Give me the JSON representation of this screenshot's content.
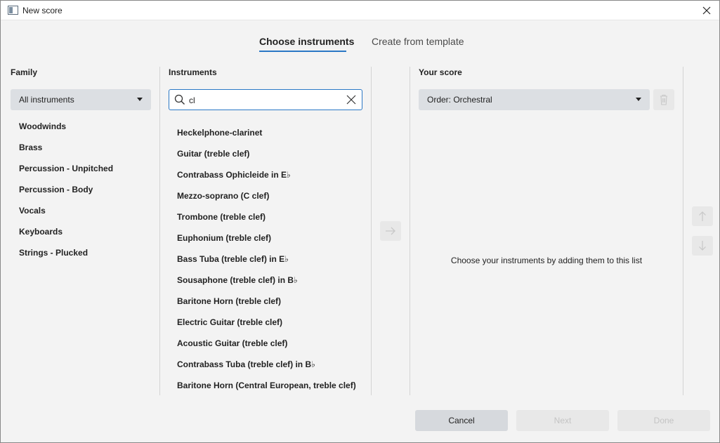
{
  "window": {
    "title": "New score"
  },
  "tabs": [
    {
      "label": "Choose instruments",
      "active": true
    },
    {
      "label": "Create from template",
      "active": false
    }
  ],
  "family": {
    "heading": "Family",
    "dropdown_value": "All instruments",
    "items": [
      "Woodwinds",
      "Brass",
      "Percussion - Unpitched",
      "Percussion - Body",
      "Vocals",
      "Keyboards",
      "Strings - Plucked"
    ]
  },
  "instruments": {
    "heading": "Instruments",
    "search_value": "cl",
    "items": [
      "Heckelphone-clarinet",
      "Guitar (treble clef)",
      "Contrabass Ophicleide in E♭",
      "Mezzo-soprano (C clef)",
      "Trombone (treble clef)",
      "Euphonium (treble clef)",
      "Bass Tuba (treble clef) in E♭",
      "Sousaphone (treble clef) in B♭",
      "Baritone Horn (treble clef)",
      "Electric Guitar (treble clef)",
      "Acoustic Guitar (treble clef)",
      "Contrabass Tuba (treble clef) in B♭",
      "Baritone Horn (Central European, treble clef)"
    ]
  },
  "your_score": {
    "heading": "Your score",
    "order_value": "Order: Orchestral",
    "empty_message": "Choose your instruments by adding them to this list"
  },
  "footer": {
    "cancel": "Cancel",
    "next": "Next",
    "done": "Done"
  },
  "colors": {
    "accent": "#2a78c5",
    "background": "#f3f3f3"
  }
}
